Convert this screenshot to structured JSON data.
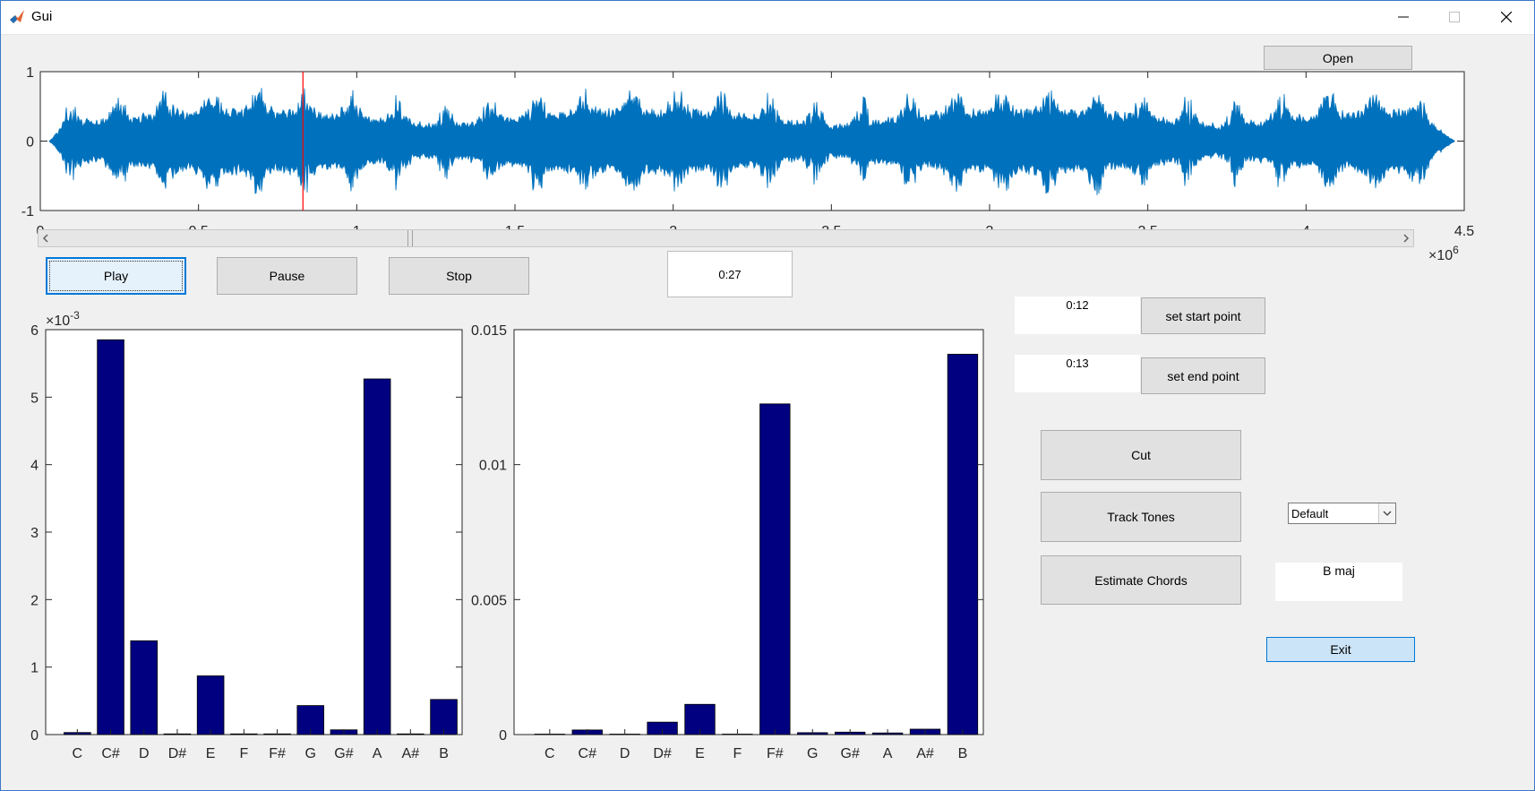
{
  "window": {
    "title": "Gui"
  },
  "buttons": {
    "open": "Open",
    "play": "Play",
    "pause": "Pause",
    "stop": "Stop",
    "set_start": "set start point",
    "set_end": "set end point",
    "cut": "Cut",
    "track_tones": "Track Tones",
    "estimate_chords": "Estimate Chords",
    "exit": "Exit"
  },
  "fields": {
    "current_time": "0:27",
    "start_point": "0:12",
    "end_point": "0:13",
    "chord_result": "B maj"
  },
  "dropdown": {
    "selected": "Default"
  },
  "slider": {
    "fraction": 0.264
  },
  "chart_data": [
    {
      "type": "line",
      "x_ticks": [
        "0",
        "0.5",
        "1",
        "1.5",
        "2",
        "2.5",
        "3",
        "3.5",
        "4",
        "4.5"
      ],
      "y_ticks": [
        "-1",
        "0",
        "1"
      ],
      "xlim": [
        0,
        4500000
      ],
      "ylim": [
        -1,
        1
      ],
      "x_multiplier": "×10",
      "x_multiplier_exp": "6",
      "playhead_x": 830000,
      "signal_end": 4470000,
      "colors": {
        "signal": "#0072bd",
        "playhead": "#ff0000"
      }
    },
    {
      "type": "bar",
      "categories": [
        "C",
        "C#",
        "D",
        "D#",
        "E",
        "F",
        "F#",
        "G",
        "G#",
        "A",
        "A#",
        "B"
      ],
      "values": [
        3e-05,
        0.00585,
        0.00139,
        1e-05,
        0.00087,
        1e-05,
        1e-05,
        0.00043,
        7e-05,
        0.00527,
        1e-05,
        0.00052
      ],
      "ylim": [
        0,
        0.006
      ],
      "y_ticks": [
        "0",
        "1",
        "2",
        "3",
        "4",
        "5",
        "6"
      ],
      "y_multiplier": "×10",
      "y_multiplier_exp": "-3",
      "bar_color": "#000080"
    },
    {
      "type": "bar",
      "categories": [
        "C",
        "C#",
        "D",
        "D#",
        "E",
        "F",
        "F#",
        "G",
        "G#",
        "A",
        "A#",
        "B"
      ],
      "values": [
        0.0,
        0.00017,
        0.0,
        0.00046,
        0.00112,
        0.0,
        0.01225,
        7e-05,
        9e-05,
        6e-05,
        0.0002,
        0.01409
      ],
      "ylim": [
        0,
        0.015
      ],
      "y_ticks": [
        "0",
        "0.005",
        "0.01",
        "0.015"
      ],
      "bar_color": "#000080"
    }
  ]
}
